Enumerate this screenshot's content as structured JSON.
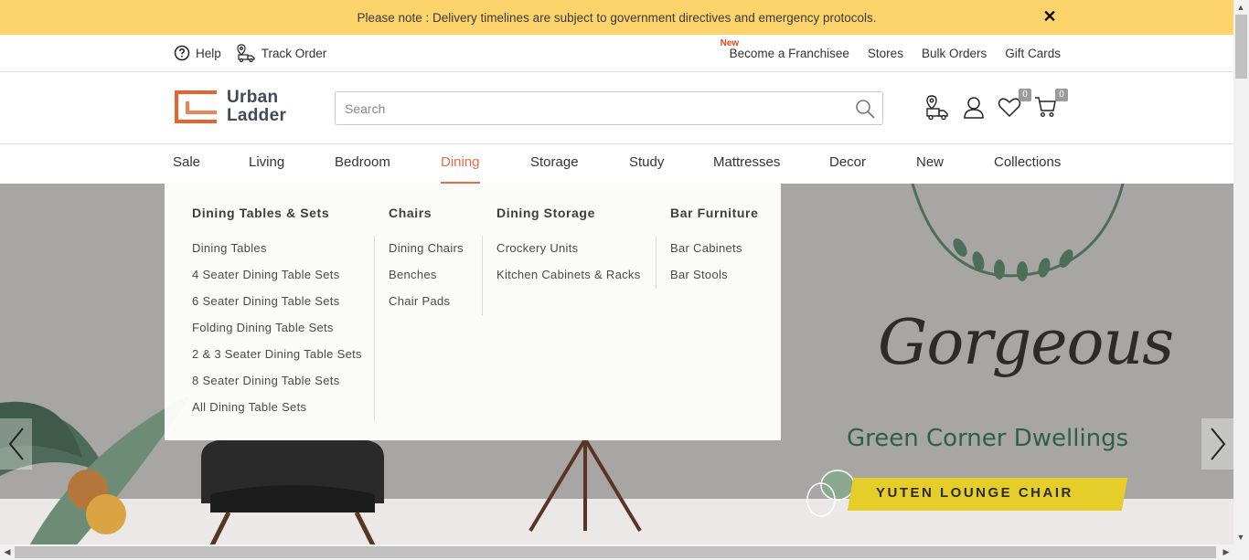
{
  "notice": {
    "text": "Please note : Delivery timelines are subject to government directives and emergency protocols.",
    "close": "✕"
  },
  "utility": {
    "help": "Help",
    "track_order": "Track Order",
    "new_tag": "New",
    "franchise": "Become a Franchisee",
    "stores": "Stores",
    "bulk_orders": "Bulk Orders",
    "gift_cards": "Gift Cards"
  },
  "brand": {
    "line1": "Urban",
    "line2": "Ladder",
    "accent": "#e8632f"
  },
  "search": {
    "placeholder": "Search",
    "value": ""
  },
  "header_icons": {
    "wishlist_count": "0",
    "cart_count": "0"
  },
  "nav": {
    "items": [
      "Sale",
      "Living",
      "Bedroom",
      "Dining",
      "Storage",
      "Study",
      "Mattresses",
      "Decor",
      "New",
      "Collections"
    ],
    "active": "Dining",
    "active_color": "#e86a4c"
  },
  "mega_menu": {
    "columns": [
      {
        "heading": "Dining Tables & Sets",
        "items": [
          "Dining Tables",
          "4 Seater Dining Table Sets",
          "6 Seater Dining Table Sets",
          "Folding Dining Table Sets",
          "2 & 3 Seater Dining Table Sets",
          "8 Seater Dining Table Sets",
          "All Dining Table Sets"
        ]
      },
      {
        "heading": "Chairs",
        "items": [
          "Dining Chairs",
          "Benches",
          "Chair Pads"
        ]
      },
      {
        "heading": "Dining Storage",
        "items": [
          "Crockery Units",
          "Kitchen Cabinets & Racks"
        ]
      },
      {
        "heading": "Bar Furniture",
        "items": [
          "Bar Cabinets",
          "Bar Stools"
        ]
      }
    ]
  },
  "hero": {
    "headline": "Gorgeous",
    "subheadline": "Green Corner Dwellings",
    "product": "YUTEN LOUNGE CHAIR"
  },
  "colors": {
    "notice_bg": "#fdd46b",
    "brand_accent": "#e8632f",
    "hero_green": "#2e6046",
    "hero_yellow": "#e6ce2a"
  }
}
